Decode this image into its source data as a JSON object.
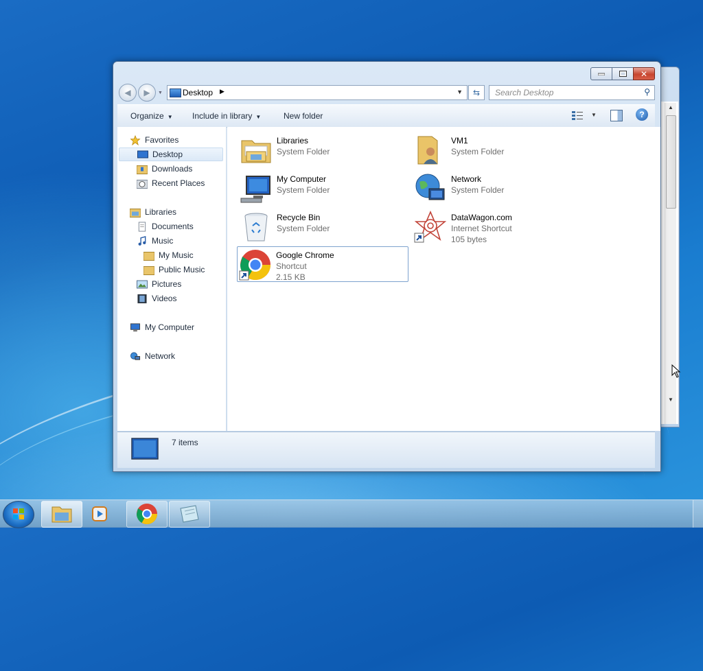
{
  "window": {
    "address": "Desktop",
    "search_placeholder": "Search Desktop",
    "caption_buttons": [
      "minimize",
      "maximize",
      "close"
    ]
  },
  "toolbar": {
    "organize": "Organize",
    "include_in_library": "Include in library",
    "new_folder": "New folder"
  },
  "nav": {
    "favorites": "Favorites",
    "desktop": "Desktop",
    "downloads": "Downloads",
    "recent_places": "Recent Places",
    "libraries": "Libraries",
    "documents": "Documents",
    "music": "Music",
    "my_music": "My Music",
    "public_music": "Public Music",
    "pictures": "Pictures",
    "videos": "Videos",
    "my_computer": "My Computer",
    "network": "Network"
  },
  "items": [
    {
      "name": "Libraries",
      "type": "System Folder",
      "size": "",
      "icon": "libraries-icon"
    },
    {
      "name": "VM1",
      "type": "System Folder",
      "size": "",
      "icon": "user-folder-icon"
    },
    {
      "name": "My Computer",
      "type": "System Folder",
      "size": "",
      "icon": "computer-icon"
    },
    {
      "name": "Network",
      "type": "System Folder",
      "size": "",
      "icon": "network-icon"
    },
    {
      "name": "Recycle Bin",
      "type": "System Folder",
      "size": "",
      "icon": "recycle-bin-icon"
    },
    {
      "name": "DataWagon.com",
      "type": "Internet Shortcut",
      "size": "105 bytes",
      "icon": "internet-shortcut-icon"
    },
    {
      "name": "Google Chrome",
      "type": "Shortcut",
      "size": "2.15 KB",
      "icon": "chrome-icon",
      "selected": true
    }
  ],
  "status": {
    "count": "7 items"
  },
  "taskbar": {
    "buttons": [
      "start-button",
      "explorer",
      "media-player",
      "chrome",
      "notepad"
    ]
  }
}
